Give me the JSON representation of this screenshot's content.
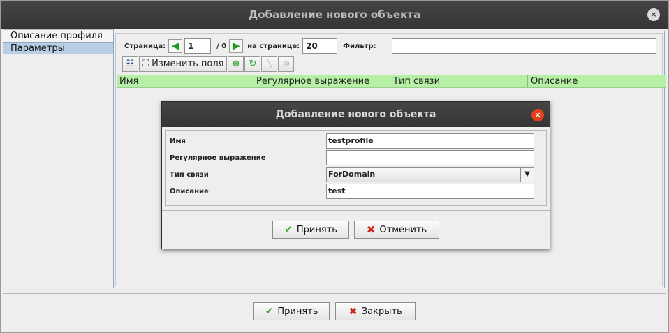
{
  "window": {
    "title": "Добавление нового объекта",
    "close_symbol": "×"
  },
  "tabs": [
    {
      "label": "Описание профиля",
      "selected": false
    },
    {
      "label": "Параметры",
      "selected": true
    }
  ],
  "pager": {
    "page_label": "Страница:",
    "page_value": "1",
    "total_label": "/ 0",
    "per_page_label": "на странице:",
    "per_page_value": "20",
    "filter_label": "Фильтр:",
    "filter_value": ""
  },
  "toolbar": {
    "edit_fields_label": "Изменить поля"
  },
  "table": {
    "columns": [
      "Имя",
      "Регулярное выражение",
      "Тип связи",
      "Описание"
    ]
  },
  "dialog": {
    "title": "Добавление нового объекта",
    "fields": [
      {
        "label": "Имя",
        "value": "testprofile"
      },
      {
        "label": "Регулярное выражение",
        "value": ""
      },
      {
        "label": "Тип связи",
        "value": "ForDomain"
      },
      {
        "label": "Описание",
        "value": "test"
      }
    ],
    "accept_label": "Принять",
    "cancel_label": "Отменить"
  },
  "footer": {
    "accept_label": "Принять",
    "close_label": "Закрыть"
  },
  "icons": [
    "close-icon",
    "arrow-left-icon",
    "arrow-right-icon",
    "list-icon",
    "fullscreen-icon",
    "add-icon",
    "refresh-icon",
    "edit-icon",
    "delete-icon",
    "check-icon",
    "cross-icon",
    "chevron-down-icon"
  ],
  "colors": {
    "header_bg": "#b5f0a5",
    "selected_tab": "#b8cfe5",
    "title_bg": "#3d3d3d",
    "danger": "#e2401c",
    "ok": "#3aa63a"
  }
}
